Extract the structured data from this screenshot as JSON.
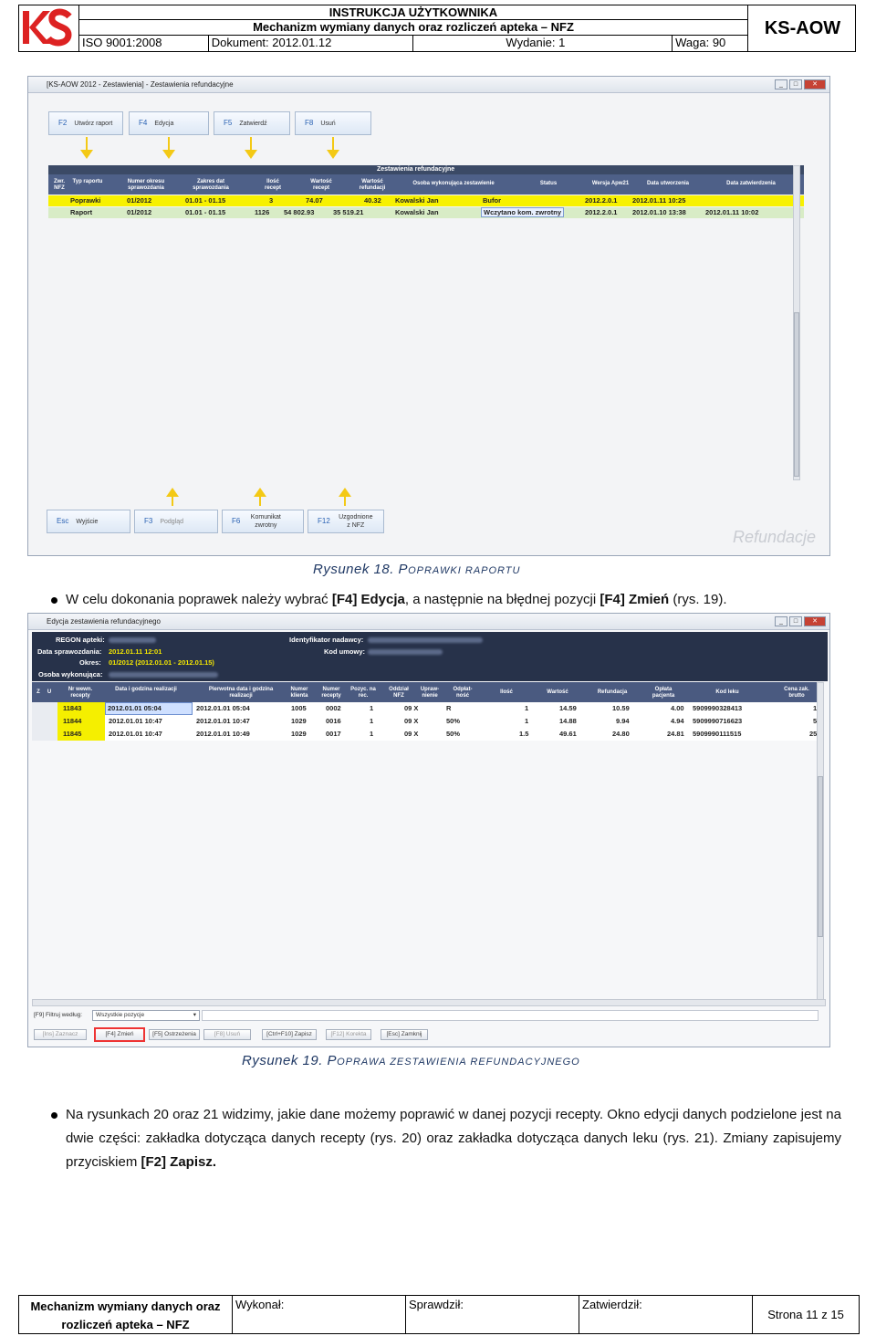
{
  "header": {
    "logo": "KS",
    "title": "INSTRUKCJA UŻYTKOWNIKA",
    "subtitle": "Mechanizm wymiany danych oraz rozliczeń apteka – NFZ",
    "iso": "ISO 9001:2008",
    "dokument": "Dokument: 2012.01.12",
    "wydanie": "Wydanie: 1",
    "waga": "Waga: 90",
    "code": "KS-AOW"
  },
  "shot1": {
    "window_title": "[KS-AOW 2012 - Zestawienia] - Zestawienia refundacyjne",
    "fkeys": [
      {
        "key": "F2",
        "label": "Utwórz raport"
      },
      {
        "key": "F4",
        "label": "Edycja"
      },
      {
        "key": "F5",
        "label": "Zatwierdź"
      },
      {
        "key": "F8",
        "label": "Usuń"
      }
    ],
    "grid_title": "Zestawienia refundacyjne",
    "columns": [
      "Zwr. NFZ",
      "Typ raportu",
      "Numer okresu sprawozdania",
      "Zakres dat sprawozdania",
      "Ilość recept",
      "Wartość recept",
      "Wartość refundacji",
      "Osoba wykonująca zestawienie",
      "Status",
      "Wersja Apw21",
      "Data utworzenia",
      "Data zatwierdzenia"
    ],
    "rows": [
      {
        "typ": "Poprawki",
        "okres": "01/2012",
        "zakres": "01.01 - 01.15",
        "ilosc": "3",
        "wartosc": "74.07",
        "refundacja": "40.32",
        "osoba": "Kowalski Jan",
        "status": "Bufor",
        "wersja": "2012.2.0.1",
        "utworzenia": "2012.01.11 10:25",
        "zatwierdzenia": ""
      },
      {
        "typ": "Raport",
        "okres": "01/2012",
        "zakres": "01.01 - 01.15",
        "ilosc": "1126",
        "wartosc": "54 802.93",
        "refundacja": "35 519.21",
        "osoba": "Kowalski Jan",
        "status": "Wczytano kom. zwrotny",
        "wersja": "2012.2.0.1",
        "utworzenia": "2012.01.10 13:38",
        "zatwierdzenia": "2012.01.11 10:02"
      }
    ],
    "bottom_keys": [
      {
        "key": "Esc",
        "label": "Wyjście"
      },
      {
        "key": "F3",
        "label": "Podgląd"
      },
      {
        "key": "F6",
        "label": "Komunikat zwrotny"
      },
      {
        "key": "F12",
        "label": "Uzgodnione z NFZ"
      }
    ],
    "watermark": "Refundacje"
  },
  "caption1": {
    "prefix": "Rysunek 18. ",
    "first": "P",
    "rest": "OPRAWKI RAPORTU"
  },
  "para1": {
    "t1": "W celu dokonania poprawek należy wybrać ",
    "b1": "[F4] Edycja",
    "t2": ", a następnie na błędnej pozycji ",
    "b2": "[F4] Zmień",
    "t3": " (rys. 19)."
  },
  "shot2": {
    "window_title": "Edycja zestawienia refundacyjnego",
    "info_labels": [
      "REGON apteki:",
      "Data sprawozdania:",
      "Okres:",
      "Osoba wykonująca:",
      "Identyfikator nadawcy:",
      "Kod umowy:"
    ],
    "info_values": [
      "",
      "2012.01.11 12:01",
      "01/2012 (2012.01.01 - 2012.01.15)",
      ""
    ],
    "columns": [
      "Z",
      "U",
      "Nr wewn. recepty",
      "Data i godzina realizacji",
      "Pierwotna data i godzina realizacji",
      "Numer klienta",
      "Numer recepty",
      "Pozyc. na rec.",
      "Oddział NFZ",
      "Upraw- nienie",
      "Odpłat- ność",
      "Ilość",
      "Wartość",
      "Refundacja",
      "Opłata pacjenta",
      "Kod leku",
      "Cena zak. brutto"
    ],
    "rows": [
      {
        "nr": "11843",
        "data": "2012.01.01 05:04",
        "pierw": "2012.01.01 05:04",
        "klient": "1005",
        "recepta": "0002",
        "poz": "1",
        "oddzial": "09 X",
        "upr": "R",
        "odpl": "",
        "ilosc": "1",
        "wartosc": "14.59",
        "refund": "10.59",
        "oplata": "4.00",
        "kod": "5909990328413",
        "cena": "1"
      },
      {
        "nr": "11844",
        "data": "2012.01.01 10:47",
        "pierw": "2012.01.01 10:47",
        "klient": "1029",
        "recepta": "0016",
        "poz": "1",
        "oddzial": "09 X",
        "upr": "",
        "odpl": "50%",
        "ilosc": "1",
        "wartosc": "14.88",
        "refund": "9.94",
        "oplata": "4.94",
        "kod": "5909990716623",
        "cena": "5"
      },
      {
        "nr": "11845",
        "data": "2012.01.01 10:47",
        "pierw": "2012.01.01 10:49",
        "klient": "1029",
        "recepta": "0017",
        "poz": "1",
        "oddzial": "09 X",
        "upr": "",
        "odpl": "50%",
        "ilosc": "1.5",
        "wartosc": "49.61",
        "refund": "24.80",
        "oplata": "24.81",
        "kod": "5909990111515",
        "cena": "25"
      }
    ],
    "filter_label": "[F9] Filtruj według:",
    "filter_value": "Wszystkie pozycje",
    "buttons": [
      "[Ins] Zaznacz",
      "[F4] Zmień",
      "[F5] Ostrzeżenia",
      "[F8] Usuń",
      "[Ctrl+F10] Zapisz",
      "[F12] Korekta",
      "[Esc] Zamknij"
    ]
  },
  "caption2": {
    "prefix": "Rysunek 19. ",
    "first": "P",
    "rest": "OPRAWA ZESTAWIENIA REFUNDACYJNEGO"
  },
  "para2": {
    "t1": "Na rysunkach 20 oraz 21 widzimy, jakie dane możemy poprawić w danej pozycji recepty. Okno edycji danych podzielone jest na dwie części: zakładka dotycząca danych recepty (rys. 20) oraz zakładka dotycząca danych leku (rys. 21). Zmiany zapisujemy przyciskiem ",
    "b1": "[F2] Zapisz."
  },
  "footer": {
    "c1": "Mechanizm wymiany danych oraz rozliczeń apteka – NFZ",
    "c2": "Wykonał:",
    "c3": "Sprawdził:",
    "c4": "Zatwierdził:",
    "c5": "Strona 11 z 15"
  }
}
